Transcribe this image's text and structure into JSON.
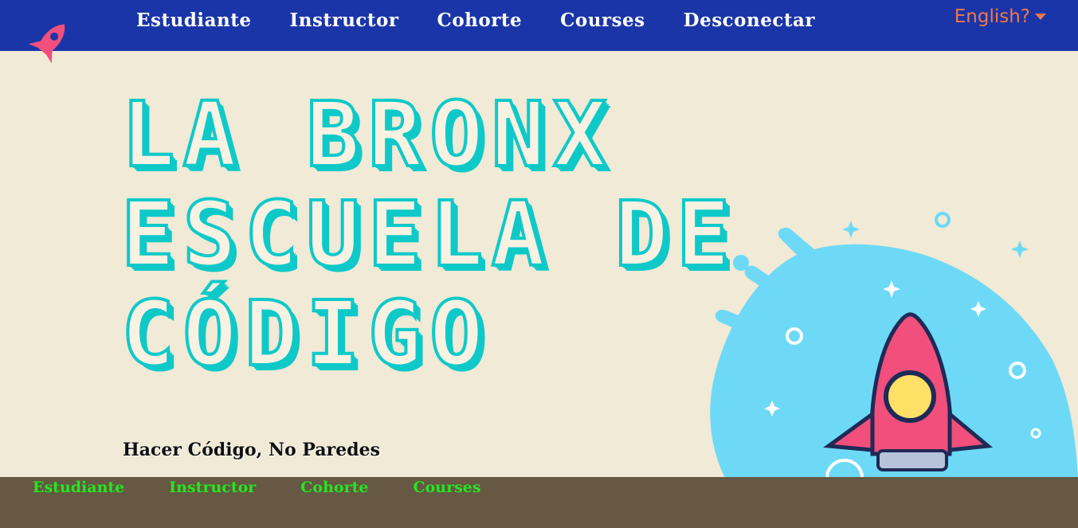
{
  "header": {
    "nav": [
      "Estudiante",
      "Instructor",
      "Cohorte",
      "Courses",
      "Desconectar"
    ],
    "language_toggle": "English?"
  },
  "hero": {
    "title_lines": [
      "LA BRONX",
      "ESCUELA DE",
      "CÓDIGO"
    ],
    "tagline": "Hacer Código, No Paredes"
  },
  "footer": {
    "nav": [
      "Estudiante",
      "Instructor",
      "Cohorte",
      "Courses"
    ]
  },
  "colors": {
    "header_bg": "#1a35a8",
    "page_bg": "#f0ead6",
    "title_accent": "#0fc9c9",
    "footer_bg": "#665843",
    "footer_link": "#22e81f",
    "lang_link": "#f0784e",
    "rocket": "#f24f7c"
  }
}
